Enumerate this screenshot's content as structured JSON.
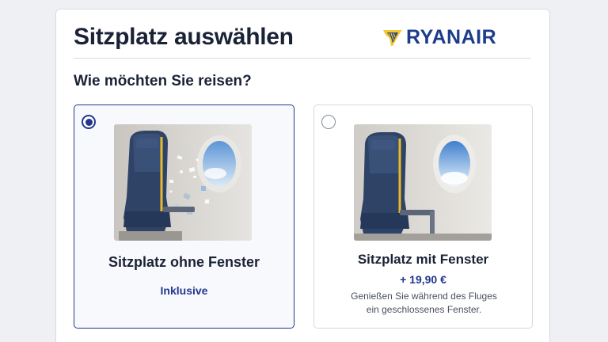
{
  "header": {
    "title": "Sitzplatz auswählen",
    "logo_text": "RYANAIR"
  },
  "question": "Wie möchten Sie reisen?",
  "options": [
    {
      "title": "Sitzplatz ohne Fenster",
      "subtitle": "Inklusive",
      "description": "",
      "selected": true,
      "image": "seat-with-broken-window"
    },
    {
      "title": "Sitzplatz mit Fenster",
      "subtitle": "+ 19,90 €",
      "description_line1": "Genießen Sie während des Fluges",
      "description_line2": "ein geschlossenes Fenster.",
      "selected": false,
      "image": "seat-with-closed-window"
    }
  ],
  "colors": {
    "accent": "#23378f",
    "brand": "#1c3c8c",
    "harp": "#f1c933",
    "background": "#eef0f3"
  }
}
